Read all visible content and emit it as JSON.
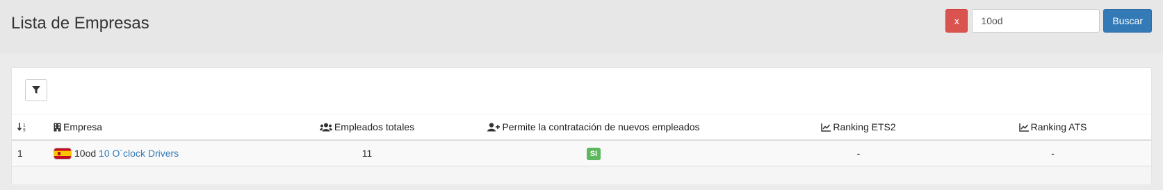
{
  "header": {
    "title": "Lista de Empresas",
    "clear_label": "x",
    "search_value": "10od",
    "search_label": "Buscar"
  },
  "table": {
    "columns": [
      "",
      "Empresa",
      "Empleados totales",
      "Permite la contratación de nuevos empleados",
      "Ranking ETS2",
      "Ranking ATS"
    ],
    "rows": [
      {
        "rank": "1",
        "tag": "10od",
        "name": "10 O´clock Drivers",
        "employees": "11",
        "hiring": "SI",
        "ranking_ets2": "-",
        "ranking_ats": "-"
      }
    ]
  },
  "icons": {
    "sort": "sort-numeric-icon",
    "building": "building-icon",
    "users": "users-icon",
    "user_plus": "user-plus-icon",
    "chart": "line-chart-icon",
    "filter": "filter-icon",
    "flag": "spain-flag-icon"
  },
  "colors": {
    "danger": "#d9534f",
    "primary": "#337ab7",
    "success": "#5cb85c"
  }
}
